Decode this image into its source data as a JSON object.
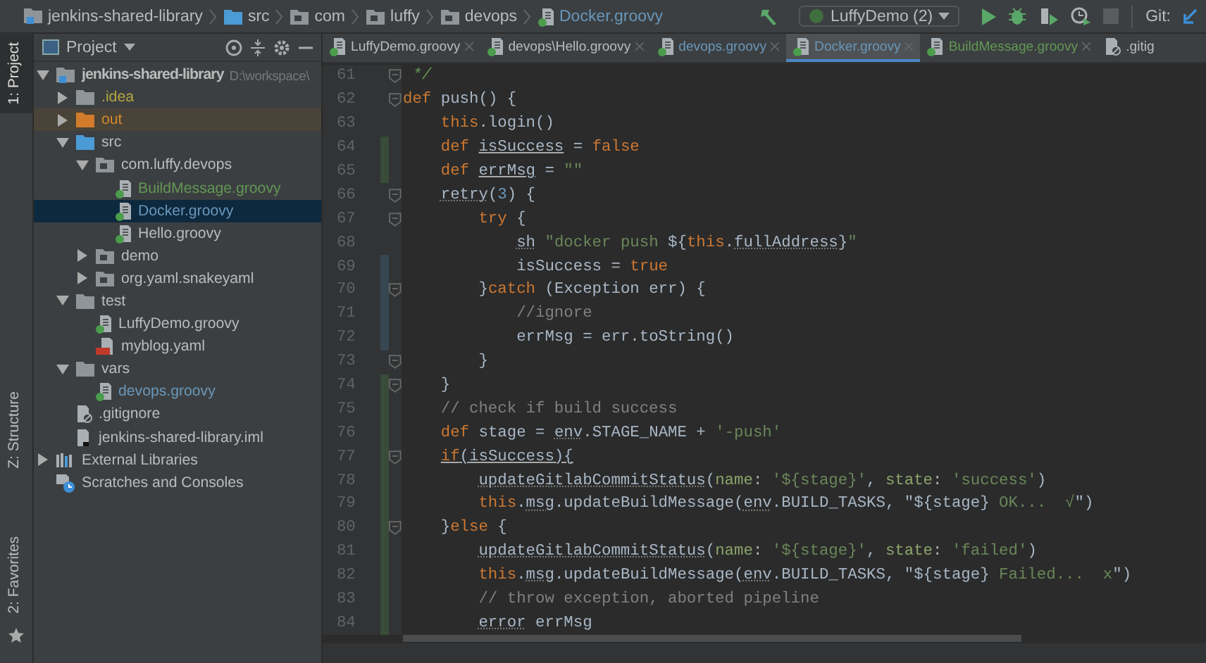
{
  "breadcrumbs": [
    {
      "label": "jenkins-shared-library",
      "kind": "module"
    },
    {
      "label": "src",
      "kind": "source-folder"
    },
    {
      "label": "com",
      "kind": "package"
    },
    {
      "label": "luffy",
      "kind": "package"
    },
    {
      "label": "devops",
      "kind": "package"
    },
    {
      "label": "Docker.groovy",
      "kind": "groovy",
      "color": "#6897bb"
    }
  ],
  "toolbar": {
    "run_configuration": "LuffyDemo (2)",
    "vcs_label": "Git:"
  },
  "tool_stripe": [
    {
      "label": "1: Project",
      "selected": true
    },
    {
      "label": "Z: Structure",
      "selected": false
    },
    {
      "label": "2: Favorites",
      "selected": false
    }
  ],
  "project_panel": {
    "title": "Project",
    "tree": [
      {
        "label": "jenkins-shared-library",
        "path": "D:\\workspace\\",
        "kind": "module",
        "expanded": true,
        "selected": false,
        "children": [
          {
            "label": ".idea",
            "kind": "folder",
            "expanded": false,
            "selected": false,
            "color": "#b5a642"
          },
          {
            "label": "out",
            "kind": "excluded-folder",
            "expanded": false,
            "selected": false,
            "color": "#d08a2c"
          },
          {
            "label": "src",
            "kind": "source-folder",
            "expanded": true,
            "selected": false,
            "children": [
              {
                "label": "com.luffy.devops",
                "kind": "package",
                "expanded": true,
                "selected": false,
                "children": [
                  {
                    "label": "BuildMessage.groovy",
                    "kind": "groovy",
                    "selected": false,
                    "color": "#629755"
                  },
                  {
                    "label": "Docker.groovy",
                    "kind": "groovy",
                    "selected": true,
                    "color": "#6897bb"
                  },
                  {
                    "label": "Hello.groovy",
                    "kind": "groovy",
                    "selected": false
                  }
                ]
              },
              {
                "label": "demo",
                "kind": "package",
                "expanded": false,
                "selected": false
              },
              {
                "label": "org.yaml.snakeyaml",
                "kind": "package",
                "expanded": false,
                "selected": false
              }
            ]
          },
          {
            "label": "test",
            "kind": "folder",
            "expanded": true,
            "selected": false,
            "children": [
              {
                "label": "LuffyDemo.groovy",
                "kind": "groovy",
                "selected": false
              },
              {
                "label": "myblog.yaml",
                "kind": "yaml",
                "selected": false
              }
            ]
          },
          {
            "label": "vars",
            "kind": "folder",
            "expanded": true,
            "selected": false,
            "children": [
              {
                "label": "devops.groovy",
                "kind": "groovy",
                "selected": false,
                "color": "#6897bb"
              }
            ]
          },
          {
            "label": ".gitignore",
            "kind": "gitignore",
            "selected": false
          },
          {
            "label": "jenkins-shared-library.iml",
            "kind": "iml",
            "selected": false
          }
        ]
      },
      {
        "label": "External Libraries",
        "kind": "libraries",
        "expanded": false,
        "selected": false
      },
      {
        "label": "Scratches and Consoles",
        "kind": "scratches",
        "selected": false
      }
    ]
  },
  "editor": {
    "tabs": [
      {
        "label": "LuffyDemo.groovy",
        "selected": false
      },
      {
        "label": "devops\\Hello.groovy",
        "selected": false
      },
      {
        "label": "devops.groovy",
        "selected": false,
        "color": "#6897bb"
      },
      {
        "label": "Docker.groovy",
        "selected": true,
        "color": "#6897bb"
      },
      {
        "label": "BuildMessage.groovy",
        "selected": false,
        "color": "#629755"
      },
      {
        "label": ".gitig",
        "selected": false,
        "kind": "gitignore"
      }
    ],
    "lines": [
      {
        "number": "61",
        "fold": true,
        "tokens": [
          {
            "kind": "doc",
            "text": " */"
          }
        ]
      },
      {
        "number": "62",
        "fold": true,
        "tokens": [
          {
            "kind": "keyword",
            "text": "def"
          },
          {
            "kind": "plain",
            "text": " push() {"
          }
        ]
      },
      {
        "number": "63",
        "fold": false,
        "tokens": [
          {
            "kind": "keyword",
            "text": "    this"
          },
          {
            "kind": "plain",
            "text": ".login()"
          }
        ]
      },
      {
        "number": "64",
        "fold": false,
        "color": "#384c38",
        "tokens": [
          {
            "kind": "keyword",
            "text": "    def "
          },
          {
            "kind": "underlined",
            "text": "isSuccess"
          },
          {
            "kind": "plain",
            "text": " = "
          },
          {
            "kind": "keyword",
            "text": "false"
          }
        ]
      },
      {
        "number": "65",
        "fold": false,
        "color": "#384c38",
        "tokens": [
          {
            "kind": "keyword",
            "text": "    def "
          },
          {
            "kind": "underlined",
            "text": "errMsg"
          },
          {
            "kind": "plain",
            "text": " = "
          },
          {
            "kind": "string",
            "text": "\"\""
          }
        ]
      },
      {
        "number": "66",
        "fold": true,
        "tokens": [
          {
            "kind": "dotted",
            "text": "    retry"
          },
          {
            "kind": "plain",
            "text": "("
          },
          {
            "kind": "number",
            "text": "3"
          },
          {
            "kind": "plain",
            "text": ") {"
          }
        ]
      },
      {
        "number": "67",
        "fold": true,
        "tokens": [
          {
            "kind": "keyword",
            "text": "        try"
          },
          {
            "kind": "plain",
            "text": " {"
          }
        ]
      },
      {
        "number": "68",
        "fold": false,
        "tokens": [
          {
            "kind": "dotted",
            "text": "            sh"
          },
          {
            "kind": "string",
            "text": " \"docker push "
          },
          {
            "kind": "plain",
            "text": "${"
          },
          {
            "kind": "keyword",
            "text": "this"
          },
          {
            "kind": "plain",
            "text": "."
          },
          {
            "kind": "dotted",
            "text": "fullAddress"
          },
          {
            "kind": "plain",
            "text": "}"
          },
          {
            "kind": "string",
            "text": "\""
          }
        ]
      },
      {
        "number": "69",
        "fold": false,
        "color": "#374752",
        "tokens": [
          {
            "kind": "plain",
            "text": "            isSuccess = "
          },
          {
            "kind": "keyword",
            "text": "true"
          }
        ]
      },
      {
        "number": "70",
        "fold": true,
        "color": "#374752",
        "tokens": [
          {
            "kind": "plain",
            "text": "        }"
          },
          {
            "kind": "keyword",
            "text": "catch"
          },
          {
            "kind": "plain",
            "text": " (Exception err) {"
          }
        ]
      },
      {
        "number": "71",
        "fold": false,
        "color": "#374752",
        "tokens": [
          {
            "kind": "comment",
            "text": "            //ignore"
          }
        ]
      },
      {
        "number": "72",
        "fold": false,
        "color": "#374752",
        "tokens": [
          {
            "kind": "plain",
            "text": "            errMsg = err.toString()"
          }
        ]
      },
      {
        "number": "73",
        "fold": true,
        "tokens": [
          {
            "kind": "plain",
            "text": "        }"
          }
        ]
      },
      {
        "number": "74",
        "fold": true,
        "color": "#384c38",
        "tokens": [
          {
            "kind": "plain",
            "text": "    }"
          }
        ]
      },
      {
        "number": "75",
        "fold": false,
        "color": "#384c38",
        "tokens": [
          {
            "kind": "comment",
            "text": "    // check if build success"
          }
        ]
      },
      {
        "number": "76",
        "fold": false,
        "color": "#384c38",
        "tokens": [
          {
            "kind": "keyword",
            "text": "    def"
          },
          {
            "kind": "plain",
            "text": " stage = "
          },
          {
            "kind": "dotted",
            "text": "env"
          },
          {
            "kind": "plain",
            "text": ".STAGE_NAME + "
          },
          {
            "kind": "string",
            "text": "'-push'"
          }
        ]
      },
      {
        "number": "77",
        "fold": true,
        "color": "#384c38",
        "tokens": [
          {
            "kind": "underlined-keyword",
            "text": "    if"
          },
          {
            "kind": "underlined",
            "text": "(isSuccess){"
          }
        ]
      },
      {
        "number": "78",
        "fold": false,
        "color": "#384c38",
        "tokens": [
          {
            "kind": "dotted",
            "text": "        updateGitlabCommitStatus"
          },
          {
            "kind": "plain",
            "text": "("
          },
          {
            "kind": "param",
            "text": "name"
          },
          {
            "kind": "plain",
            "text": ": "
          },
          {
            "kind": "string",
            "text": "'${stage}'"
          },
          {
            "kind": "plain",
            "text": ", "
          },
          {
            "kind": "param",
            "text": "state"
          },
          {
            "kind": "plain",
            "text": ": "
          },
          {
            "kind": "string",
            "text": "'success'"
          },
          {
            "kind": "plain",
            "text": ")"
          }
        ]
      },
      {
        "number": "79",
        "fold": false,
        "color": "#384c38",
        "tokens": [
          {
            "kind": "keyword",
            "text": "        this"
          },
          {
            "kind": "plain",
            "text": "."
          },
          {
            "kind": "dotted",
            "text": "msg"
          },
          {
            "kind": "plain",
            "text": ".updateBuildMessage("
          },
          {
            "kind": "dotted",
            "text": "env"
          },
          {
            "kind": "plain",
            "text": ".BUILD_TASKS, \"${stage}"
          },
          {
            "kind": "string",
            "text": " OK...  √"
          },
          {
            "kind": "plain",
            "text": "\")"
          }
        ]
      },
      {
        "number": "80",
        "fold": true,
        "color": "#384c38",
        "tokens": [
          {
            "kind": "plain",
            "text": "    }"
          },
          {
            "kind": "keyword",
            "text": "else"
          },
          {
            "kind": "plain",
            "text": " {"
          }
        ]
      },
      {
        "number": "81",
        "fold": false,
        "color": "#384c38",
        "tokens": [
          {
            "kind": "dotted",
            "text": "        updateGitlabCommitStatus"
          },
          {
            "kind": "plain",
            "text": "("
          },
          {
            "kind": "param",
            "text": "name"
          },
          {
            "kind": "plain",
            "text": ": "
          },
          {
            "kind": "string",
            "text": "'${stage}'"
          },
          {
            "kind": "plain",
            "text": ", "
          },
          {
            "kind": "param",
            "text": "state"
          },
          {
            "kind": "plain",
            "text": ": "
          },
          {
            "kind": "string",
            "text": "'failed'"
          },
          {
            "kind": "plain",
            "text": ")"
          }
        ]
      },
      {
        "number": "82",
        "fold": false,
        "color": "#384c38",
        "tokens": [
          {
            "kind": "keyword",
            "text": "        this"
          },
          {
            "kind": "plain",
            "text": "."
          },
          {
            "kind": "dotted",
            "text": "msg"
          },
          {
            "kind": "plain",
            "text": ".updateBuildMessage("
          },
          {
            "kind": "dotted",
            "text": "env"
          },
          {
            "kind": "plain",
            "text": ".BUILD_TASKS, \"${stage}"
          },
          {
            "kind": "string",
            "text": " Failed...  x"
          },
          {
            "kind": "plain",
            "text": "\")"
          }
        ]
      },
      {
        "number": "83",
        "fold": false,
        "color": "#384c38",
        "tokens": [
          {
            "kind": "comment",
            "text": "        // throw exception, aborted pipeline"
          }
        ]
      },
      {
        "number": "84",
        "fold": false,
        "color": "#384c38",
        "tokens": [
          {
            "kind": "dotted",
            "text": "        error"
          },
          {
            "kind": "plain",
            "text": " errMsg"
          }
        ]
      }
    ]
  }
}
